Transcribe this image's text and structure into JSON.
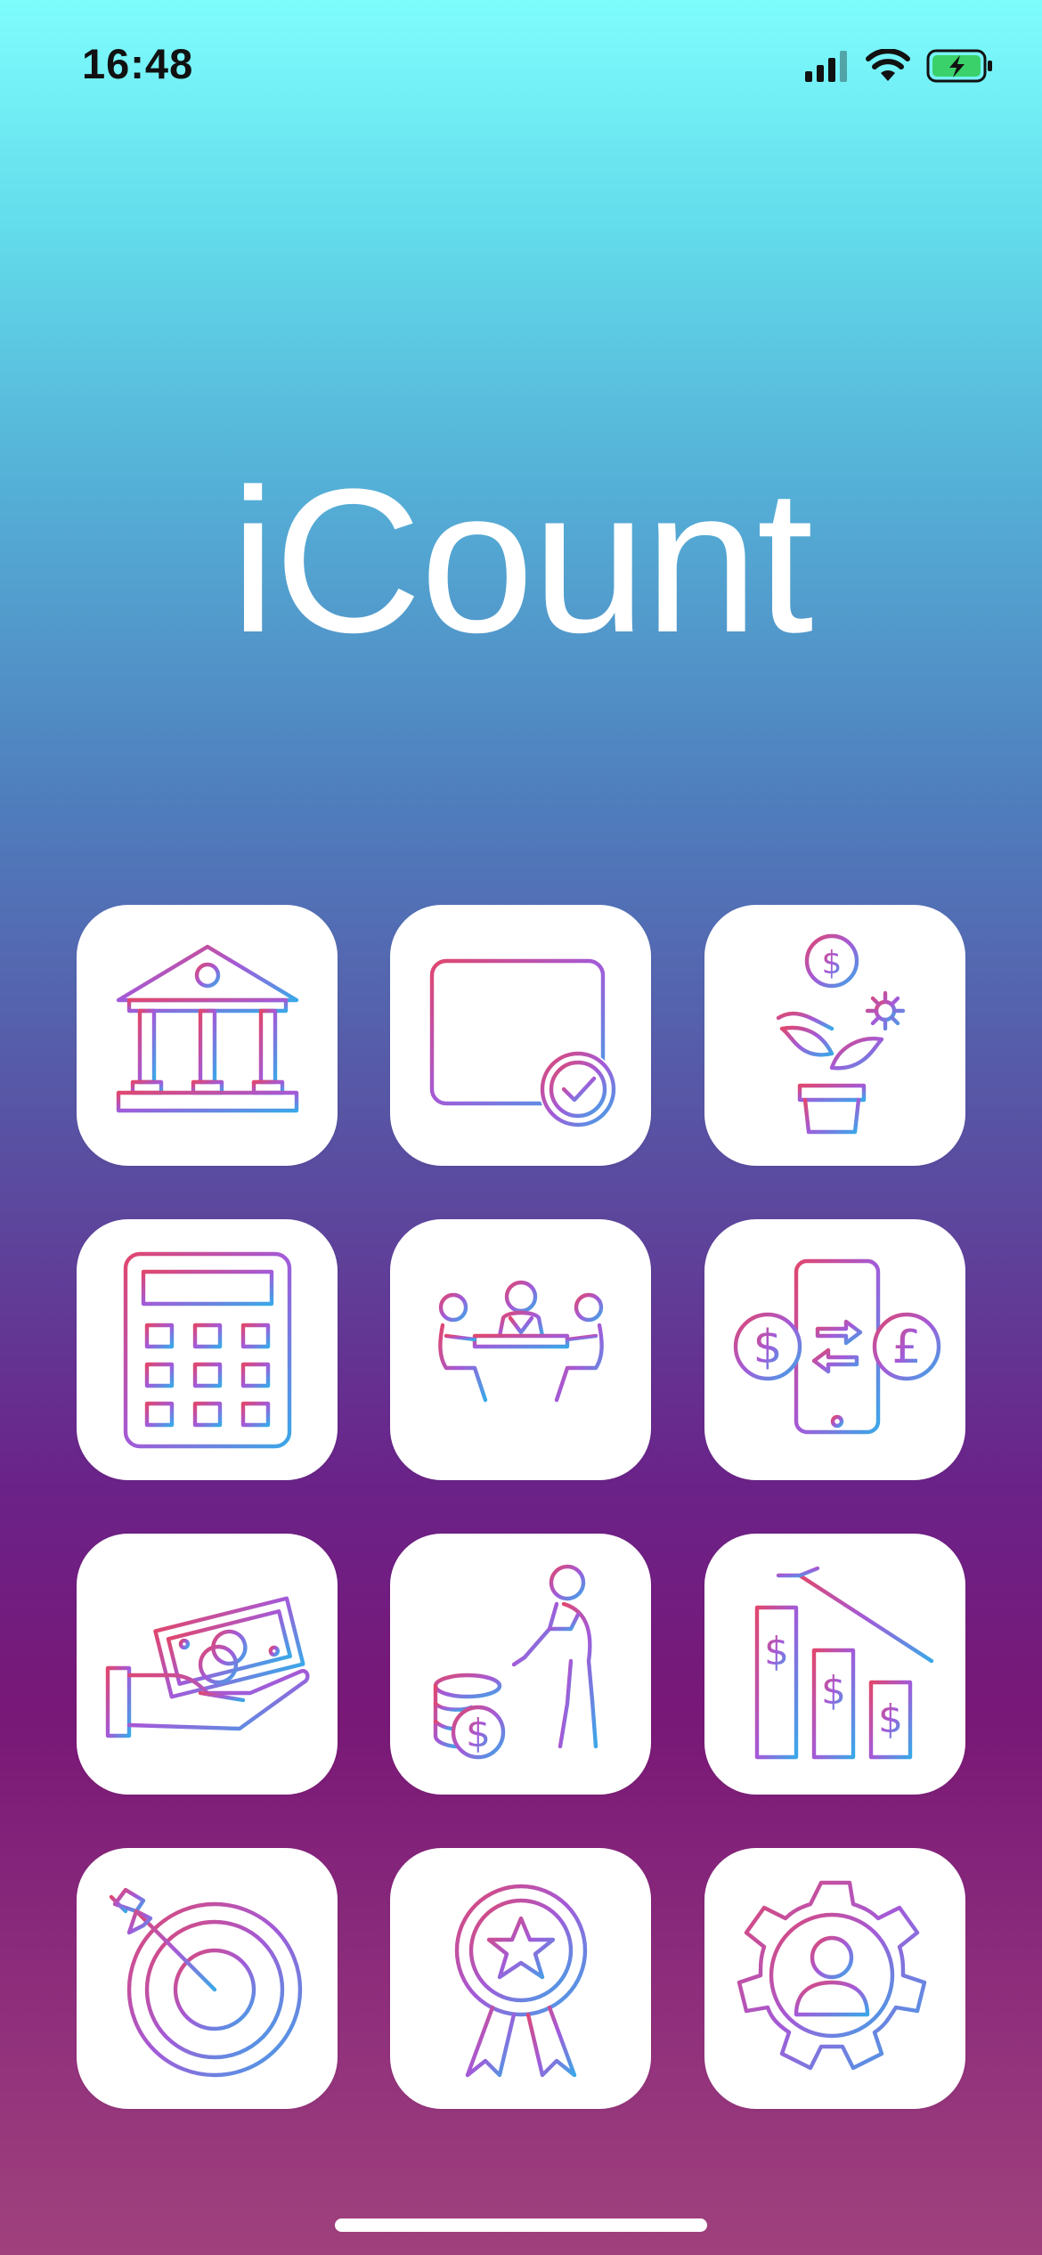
{
  "status_bar": {
    "time": "16:48",
    "icons": [
      "cellular-signal-icon",
      "wifi-icon",
      "battery-charging-icon"
    ],
    "battery_color": "#3bd16a"
  },
  "app": {
    "title": "iCount"
  },
  "grid": {
    "tiles": [
      {
        "name": "bank-icon"
      },
      {
        "name": "calendar-check-icon"
      },
      {
        "name": "money-plant-icon"
      },
      {
        "name": "calculator-icon"
      },
      {
        "name": "meeting-icon"
      },
      {
        "name": "currency-exchange-icon"
      },
      {
        "name": "hand-money-icon"
      },
      {
        "name": "retirement-savings-icon"
      },
      {
        "name": "declining-chart-icon"
      },
      {
        "name": "target-icon"
      },
      {
        "name": "award-badge-icon"
      },
      {
        "name": "user-settings-icon"
      }
    ],
    "icon_gradient": [
      "#e0476e",
      "#a35ad8",
      "#3aa8e8"
    ]
  }
}
